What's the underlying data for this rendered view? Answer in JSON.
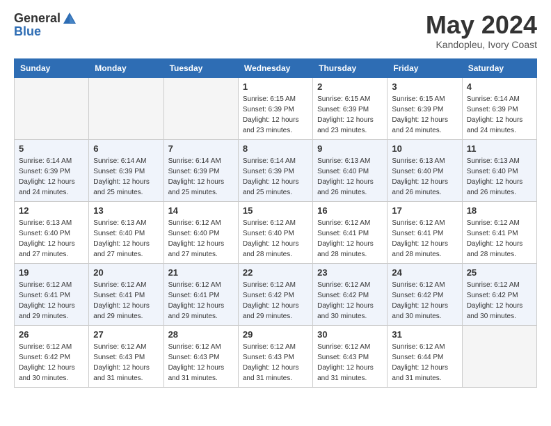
{
  "header": {
    "logo_general": "General",
    "logo_blue": "Blue",
    "month_title": "May 2024",
    "location": "Kandopleu, Ivory Coast"
  },
  "days_of_week": [
    "Sunday",
    "Monday",
    "Tuesday",
    "Wednesday",
    "Thursday",
    "Friday",
    "Saturday"
  ],
  "weeks": [
    [
      {
        "day": "",
        "info": ""
      },
      {
        "day": "",
        "info": ""
      },
      {
        "day": "",
        "info": ""
      },
      {
        "day": "1",
        "info": "Sunrise: 6:15 AM\nSunset: 6:39 PM\nDaylight: 12 hours\nand 23 minutes."
      },
      {
        "day": "2",
        "info": "Sunrise: 6:15 AM\nSunset: 6:39 PM\nDaylight: 12 hours\nand 23 minutes."
      },
      {
        "day": "3",
        "info": "Sunrise: 6:15 AM\nSunset: 6:39 PM\nDaylight: 12 hours\nand 24 minutes."
      },
      {
        "day": "4",
        "info": "Sunrise: 6:14 AM\nSunset: 6:39 PM\nDaylight: 12 hours\nand 24 minutes."
      }
    ],
    [
      {
        "day": "5",
        "info": "Sunrise: 6:14 AM\nSunset: 6:39 PM\nDaylight: 12 hours\nand 24 minutes."
      },
      {
        "day": "6",
        "info": "Sunrise: 6:14 AM\nSunset: 6:39 PM\nDaylight: 12 hours\nand 25 minutes."
      },
      {
        "day": "7",
        "info": "Sunrise: 6:14 AM\nSunset: 6:39 PM\nDaylight: 12 hours\nand 25 minutes."
      },
      {
        "day": "8",
        "info": "Sunrise: 6:14 AM\nSunset: 6:39 PM\nDaylight: 12 hours\nand 25 minutes."
      },
      {
        "day": "9",
        "info": "Sunrise: 6:13 AM\nSunset: 6:40 PM\nDaylight: 12 hours\nand 26 minutes."
      },
      {
        "day": "10",
        "info": "Sunrise: 6:13 AM\nSunset: 6:40 PM\nDaylight: 12 hours\nand 26 minutes."
      },
      {
        "day": "11",
        "info": "Sunrise: 6:13 AM\nSunset: 6:40 PM\nDaylight: 12 hours\nand 26 minutes."
      }
    ],
    [
      {
        "day": "12",
        "info": "Sunrise: 6:13 AM\nSunset: 6:40 PM\nDaylight: 12 hours\nand 27 minutes."
      },
      {
        "day": "13",
        "info": "Sunrise: 6:13 AM\nSunset: 6:40 PM\nDaylight: 12 hours\nand 27 minutes."
      },
      {
        "day": "14",
        "info": "Sunrise: 6:12 AM\nSunset: 6:40 PM\nDaylight: 12 hours\nand 27 minutes."
      },
      {
        "day": "15",
        "info": "Sunrise: 6:12 AM\nSunset: 6:40 PM\nDaylight: 12 hours\nand 28 minutes."
      },
      {
        "day": "16",
        "info": "Sunrise: 6:12 AM\nSunset: 6:41 PM\nDaylight: 12 hours\nand 28 minutes."
      },
      {
        "day": "17",
        "info": "Sunrise: 6:12 AM\nSunset: 6:41 PM\nDaylight: 12 hours\nand 28 minutes."
      },
      {
        "day": "18",
        "info": "Sunrise: 6:12 AM\nSunset: 6:41 PM\nDaylight: 12 hours\nand 28 minutes."
      }
    ],
    [
      {
        "day": "19",
        "info": "Sunrise: 6:12 AM\nSunset: 6:41 PM\nDaylight: 12 hours\nand 29 minutes."
      },
      {
        "day": "20",
        "info": "Sunrise: 6:12 AM\nSunset: 6:41 PM\nDaylight: 12 hours\nand 29 minutes."
      },
      {
        "day": "21",
        "info": "Sunrise: 6:12 AM\nSunset: 6:41 PM\nDaylight: 12 hours\nand 29 minutes."
      },
      {
        "day": "22",
        "info": "Sunrise: 6:12 AM\nSunset: 6:42 PM\nDaylight: 12 hours\nand 29 minutes."
      },
      {
        "day": "23",
        "info": "Sunrise: 6:12 AM\nSunset: 6:42 PM\nDaylight: 12 hours\nand 30 minutes."
      },
      {
        "day": "24",
        "info": "Sunrise: 6:12 AM\nSunset: 6:42 PM\nDaylight: 12 hours\nand 30 minutes."
      },
      {
        "day": "25",
        "info": "Sunrise: 6:12 AM\nSunset: 6:42 PM\nDaylight: 12 hours\nand 30 minutes."
      }
    ],
    [
      {
        "day": "26",
        "info": "Sunrise: 6:12 AM\nSunset: 6:42 PM\nDaylight: 12 hours\nand 30 minutes."
      },
      {
        "day": "27",
        "info": "Sunrise: 6:12 AM\nSunset: 6:43 PM\nDaylight: 12 hours\nand 31 minutes."
      },
      {
        "day": "28",
        "info": "Sunrise: 6:12 AM\nSunset: 6:43 PM\nDaylight: 12 hours\nand 31 minutes."
      },
      {
        "day": "29",
        "info": "Sunrise: 6:12 AM\nSunset: 6:43 PM\nDaylight: 12 hours\nand 31 minutes."
      },
      {
        "day": "30",
        "info": "Sunrise: 6:12 AM\nSunset: 6:43 PM\nDaylight: 12 hours\nand 31 minutes."
      },
      {
        "day": "31",
        "info": "Sunrise: 6:12 AM\nSunset: 6:44 PM\nDaylight: 12 hours\nand 31 minutes."
      },
      {
        "day": "",
        "info": ""
      }
    ]
  ]
}
